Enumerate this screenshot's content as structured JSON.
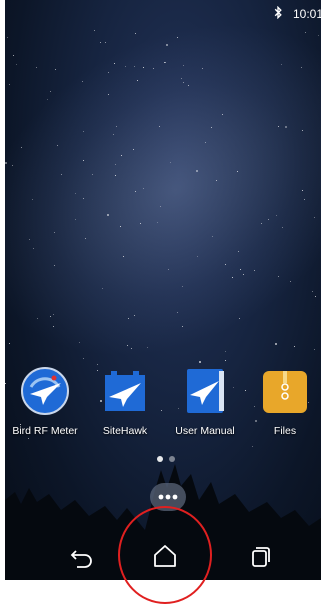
{
  "status_bar": {
    "time": "10:01",
    "bluetooth_icon": "bluetooth-icon"
  },
  "home_screen": {
    "apps": [
      {
        "label": "Bird RF Meter",
        "icon": "bird-rf-meter-icon"
      },
      {
        "label": "SiteHawk",
        "icon": "sitehawk-icon"
      },
      {
        "label": "User Manual",
        "icon": "user-manual-icon"
      },
      {
        "label": "Files",
        "icon": "files-icon"
      }
    ],
    "page_indicator": {
      "current": 1,
      "total": 2
    },
    "app_drawer_icon": "app-drawer-icon"
  },
  "navigation_bar": {
    "back_icon": "back-icon",
    "home_icon": "home-icon",
    "recents_icon": "recents-icon"
  },
  "annotation": {
    "highlight_color": "#e02020",
    "highlighted_target": "home-button"
  },
  "colors": {
    "wallpaper": "#0c1628",
    "app_icon_blue": "#1f6ad6",
    "files_icon_yellow": "#e8a72a"
  }
}
